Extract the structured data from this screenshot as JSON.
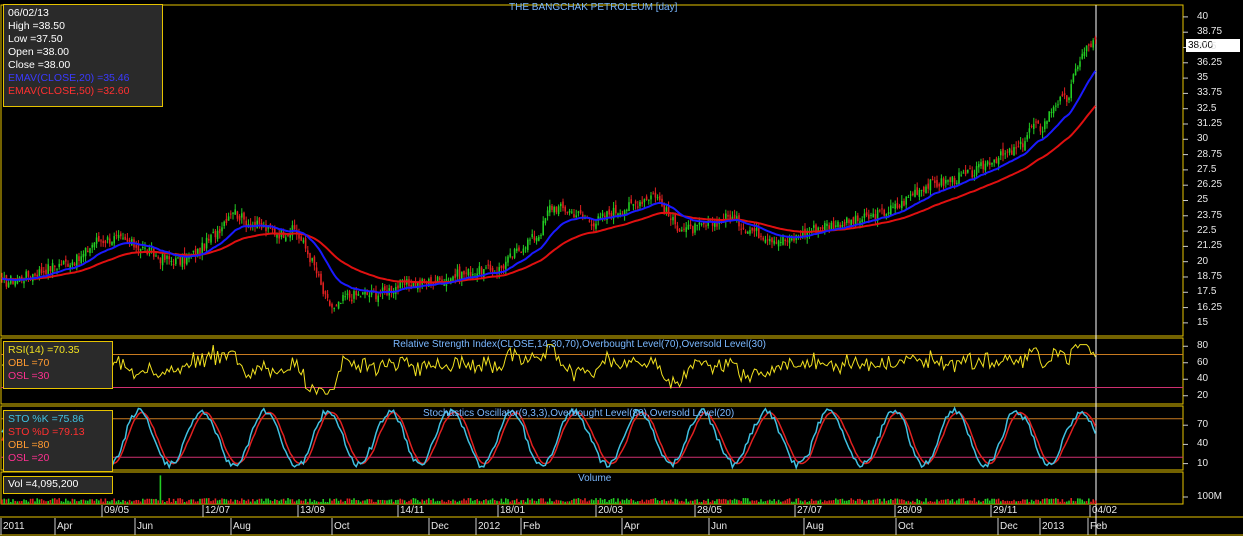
{
  "title": "THE BANGCHAK PETROLEUM [day]",
  "info": {
    "date": "06/02/13",
    "high": "High  =38.50",
    "low": "Low  =37.50",
    "open": "Open  =38.00",
    "close": "Close  =38.00",
    "ema20": "EMAV(CLOSE,20)  =35.46",
    "ema50": "EMAV(CLOSE,50)  =32.60"
  },
  "price_tag": "38.00",
  "rsi_panel": {
    "title": "Relative Strength Index(CLOSE,14,30,70),Overbought Level(70),Oversold Level(30)",
    "rsi": "RSI(14)   =70.35",
    "obl": "OBL   =70",
    "osl": "OSL   =30"
  },
  "sto_panel": {
    "title": "Stochastics Oscillator(9,3,3),Overbought Level(80),Oversold Level(20)",
    "k": "STO %K   =75.86",
    "d": "STO %D   =79.13",
    "obl": "OBL   =80",
    "osl": "OSL   =20"
  },
  "vol_panel": {
    "title": "Volume",
    "vol": "Vol   =4,095,200"
  },
  "colors": {
    "up": "#22cc22",
    "down": "#e02020",
    "ema20": "#1a1aff",
    "ema50": "#e01010",
    "rsi": "#f0e020",
    "sto_k": "#40c0e0",
    "sto_d": "#e02020",
    "frame": "#e6c300"
  },
  "chart_data": [
    {
      "type": "candlestick",
      "title": "THE BANGCHAK PETROLEUM [day]",
      "y_ticks": [
        "40",
        "38.75",
        "37.5",
        "36.25",
        "35",
        "33.75",
        "32.5",
        "31.25",
        "30",
        "28.75",
        "27.5",
        "26.25",
        "25",
        "23.75",
        "22.5",
        "21.25",
        "20",
        "18.75",
        "17.5",
        "16.25",
        "15"
      ],
      "ylim": [
        14.5,
        40.4
      ],
      "x_top_labels": [
        "09/05",
        "12/07",
        "13/09",
        "14/11",
        "18/01",
        "20/03",
        "28/05",
        "27/07",
        "28/09",
        "29/11",
        "04/02"
      ],
      "x_bottom_labels": [
        "2011",
        "Apr",
        "Jun",
        "Aug",
        "Oct",
        "Dec",
        "2012",
        "Feb",
        "Apr",
        "Jun",
        "Aug",
        "Oct",
        "Dec",
        "2013",
        "Feb"
      ],
      "close_path_keypoints": [
        [
          0,
          18.2
        ],
        [
          30,
          18.9
        ],
        [
          60,
          19.8
        ],
        [
          80,
          20.2
        ],
        [
          95,
          21.7
        ],
        [
          115,
          21.9
        ],
        [
          140,
          21.2
        ],
        [
          160,
          20.3
        ],
        [
          180,
          20.0
        ],
        [
          200,
          20.9
        ],
        [
          220,
          22.8
        ],
        [
          232,
          24.3
        ],
        [
          245,
          23.3
        ],
        [
          262,
          22.8
        ],
        [
          280,
          22.3
        ],
        [
          295,
          22.6
        ],
        [
          305,
          21.2
        ],
        [
          315,
          19.5
        ],
        [
          325,
          17.0
        ],
        [
          335,
          16.0
        ],
        [
          345,
          17.1
        ],
        [
          360,
          17.3
        ],
        [
          380,
          17.4
        ],
        [
          400,
          18.1
        ],
        [
          420,
          18.2
        ],
        [
          440,
          18.5
        ],
        [
          460,
          19.0
        ],
        [
          480,
          19.2
        ],
        [
          500,
          19.4
        ],
        [
          510,
          20.3
        ],
        [
          525,
          21.5
        ],
        [
          540,
          22.3
        ],
        [
          550,
          24.5
        ],
        [
          565,
          24.3
        ],
        [
          580,
          23.8
        ],
        [
          595,
          23.2
        ],
        [
          610,
          24.0
        ],
        [
          630,
          24.5
        ],
        [
          645,
          25.2
        ],
        [
          655,
          25.6
        ],
        [
          665,
          24.2
        ],
        [
          675,
          23.0
        ],
        [
          690,
          22.6
        ],
        [
          705,
          22.9
        ],
        [
          720,
          23.4
        ],
        [
          730,
          23.7
        ],
        [
          745,
          22.8
        ],
        [
          760,
          22.3
        ],
        [
          775,
          21.9
        ],
        [
          790,
          21.7
        ],
        [
          805,
          22.4
        ],
        [
          820,
          22.9
        ],
        [
          840,
          23.1
        ],
        [
          860,
          23.4
        ],
        [
          880,
          23.9
        ],
        [
          900,
          24.6
        ],
        [
          915,
          25.8
        ],
        [
          930,
          26.3
        ],
        [
          945,
          26.5
        ],
        [
          960,
          26.9
        ],
        [
          975,
          27.3
        ],
        [
          990,
          28.3
        ],
        [
          1005,
          28.7
        ],
        [
          1020,
          29.3
        ],
        [
          1032,
          31.1
        ],
        [
          1042,
          30.9
        ],
        [
          1055,
          33.0
        ],
        [
          1068,
          33.3
        ],
        [
          1078,
          36.3
        ],
        [
          1088,
          37.6
        ],
        [
          1096,
          38.0
        ]
      ],
      "ema20_last": 35.46,
      "ema50_last": 32.6,
      "last": {
        "date": "06/02/13",
        "high": 38.5,
        "low": 37.5,
        "open": 38.0,
        "close": 38.0
      }
    },
    {
      "type": "line",
      "title": "Relative Strength Index(CLOSE,14,30,70),Overbought Level(70),Oversold Level(30)",
      "y_ticks": [
        "80",
        "60",
        "40",
        "20"
      ],
      "ylim": [
        10,
        90
      ],
      "overbought": 70,
      "oversold": 30,
      "last": 70.35
    },
    {
      "type": "line",
      "title": "Stochastics Oscillator(9,3,3),Overbought Level(80),Oversold Level(20)",
      "y_ticks": [
        "70",
        "40",
        "10"
      ],
      "ylim": [
        0,
        100
      ],
      "overbought": 80,
      "oversold": 20,
      "k_last": 75.86,
      "d_last": 79.13
    },
    {
      "type": "bar",
      "title": "Volume",
      "y_ticks": [
        "100M"
      ],
      "last": 4095200
    }
  ]
}
